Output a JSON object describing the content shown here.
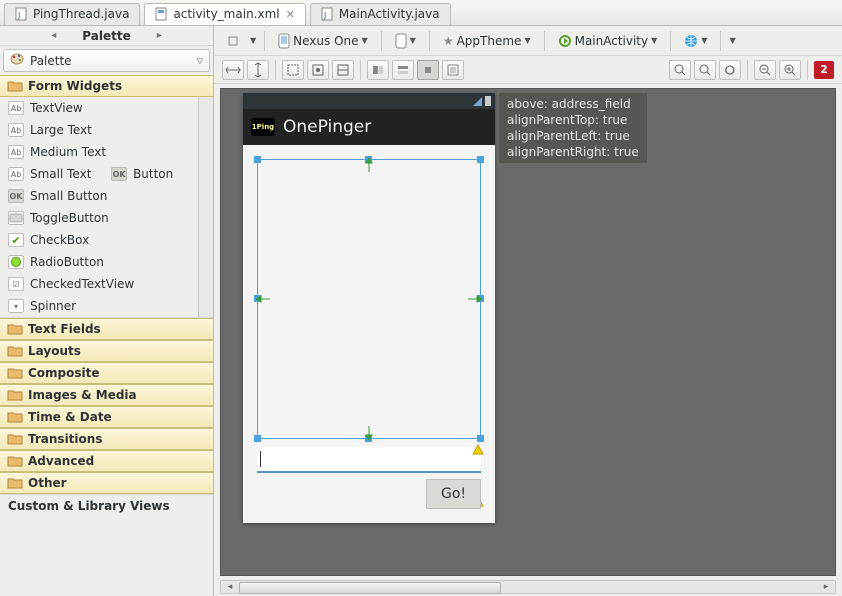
{
  "tabs": [
    {
      "label": "PingThread.java",
      "kind": "java"
    },
    {
      "label": "activity_main.xml",
      "kind": "xml",
      "active": true
    },
    {
      "label": "MainActivity.java",
      "kind": "java"
    }
  ],
  "palette": {
    "title": "Palette",
    "dropdown_label": "Palette",
    "drawers": {
      "form_widgets": "Form Widgets",
      "text_fields": "Text Fields",
      "layouts": "Layouts",
      "composite": "Composite",
      "images_media": "Images & Media",
      "time_date": "Time & Date",
      "transitions": "Transitions",
      "advanced": "Advanced",
      "other": "Other",
      "custom": "Custom & Library Views"
    },
    "widgets": {
      "textview": "TextView",
      "large_text": "Large Text",
      "medium_text": "Medium Text",
      "small_text": "Small Text",
      "button": "Button",
      "small_button": "Small Button",
      "toggle_button": "ToggleButton",
      "checkbox": "CheckBox",
      "radio_button": "RadioButton",
      "checked_textview": "CheckedTextView",
      "spinner": "Spinner"
    }
  },
  "toolbar": {
    "device": "Nexus One",
    "theme": "AppTheme",
    "activity": "MainActivity",
    "star": "★",
    "globe_color": "#3aa0d8",
    "green_arrow_color": "#5aa02c"
  },
  "zoom_badge": "2",
  "phone": {
    "app_title": "OnePinger",
    "app_logo_text": "1Ping",
    "go_label": "Go!"
  },
  "tooltip": {
    "line1": "above: address_field",
    "line2": "alignParentTop: true",
    "line3": "alignParentLeft: true",
    "line4": "alignParentRight: true"
  }
}
